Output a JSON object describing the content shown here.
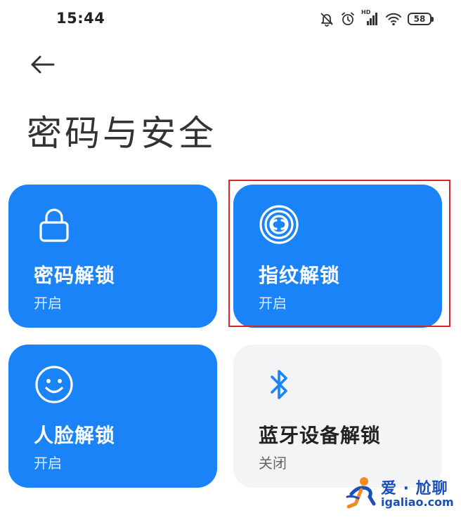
{
  "status_bar": {
    "time": "15:44",
    "battery": "58",
    "network_label": "HD",
    "icons": [
      "mute-icon",
      "alarm-icon",
      "signal-icon",
      "wifi-icon",
      "battery-icon"
    ]
  },
  "header": {
    "back_icon": "back-arrow-icon",
    "title": "密码与安全"
  },
  "cards": [
    {
      "id": "password",
      "icon": "lock-icon",
      "title": "密码解锁",
      "status": "开启",
      "active": true
    },
    {
      "id": "fingerprint",
      "icon": "fingerprint-icon",
      "title": "指纹解锁",
      "status": "开启",
      "active": true,
      "highlighted": true
    },
    {
      "id": "face",
      "icon": "smiley-face-icon",
      "title": "人脸解锁",
      "status": "开启",
      "active": true
    },
    {
      "id": "bluetooth",
      "icon": "bluetooth-icon",
      "title": "蓝牙设备解锁",
      "status": "关闭",
      "active": false
    }
  ],
  "colors": {
    "card_active": "#1a83f8",
    "card_inactive": "#f3f4f6",
    "highlight_border": "#d8262c",
    "bluetooth_icon": "#1a83f8"
  },
  "watermark": {
    "title": "爱 · 尬聊",
    "url": "igaliao.com"
  }
}
